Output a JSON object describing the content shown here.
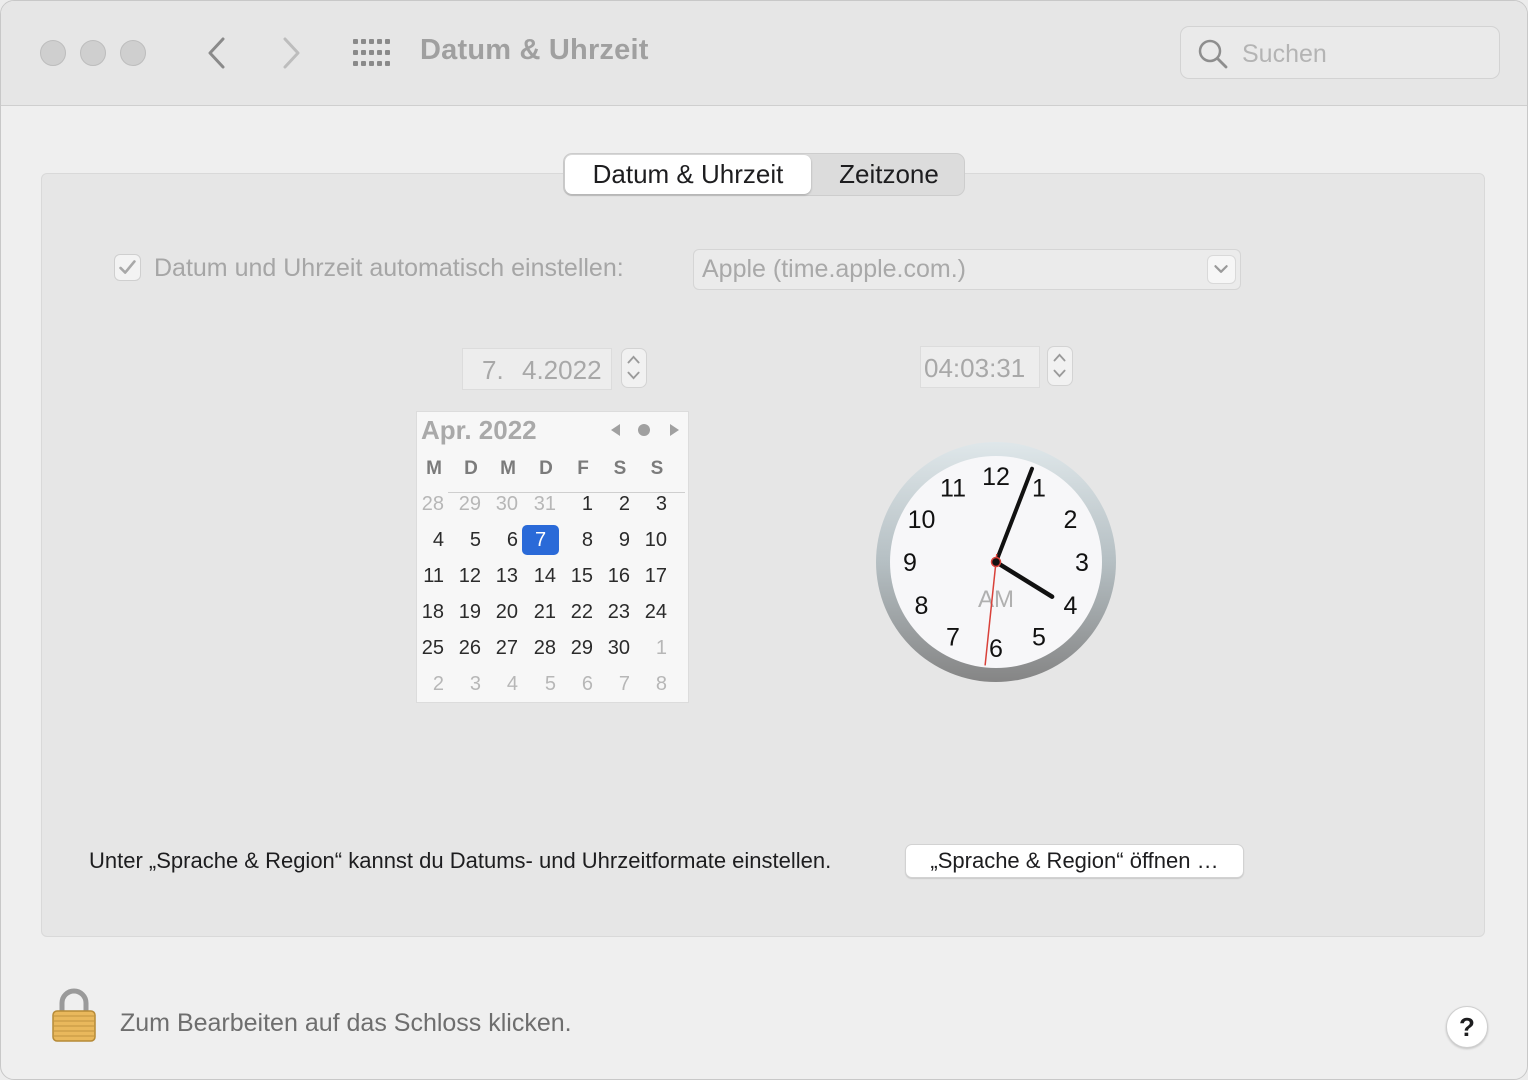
{
  "window": {
    "title": "Datum & Uhrzeit",
    "search_placeholder": "Suchen"
  },
  "tabs": [
    {
      "label": "Datum & Uhrzeit",
      "selected": true
    },
    {
      "label": "Zeitzone",
      "selected": false
    }
  ],
  "auto_time": {
    "checked": true,
    "label": "Datum und Uhrzeit automatisch einstellen:",
    "server": "Apple (time.apple.com.)"
  },
  "date_field": {
    "day": "7.",
    "rest": "4.2022"
  },
  "time_field": "04:03:31",
  "calendar": {
    "month_label": "Apr. 2022",
    "weekday_headers": [
      "M",
      "D",
      "M",
      "D",
      "F",
      "S",
      "S"
    ],
    "selected_day": "7",
    "weeks": [
      [
        {
          "d": "28",
          "dim": true
        },
        {
          "d": "29",
          "dim": true
        },
        {
          "d": "30",
          "dim": true
        },
        {
          "d": "31",
          "dim": true
        },
        {
          "d": "1"
        },
        {
          "d": "2"
        },
        {
          "d": "3"
        }
      ],
      [
        {
          "d": "4"
        },
        {
          "d": "5"
        },
        {
          "d": "6"
        },
        {
          "d": "7",
          "sel": true
        },
        {
          "d": "8"
        },
        {
          "d": "9"
        },
        {
          "d": "10"
        }
      ],
      [
        {
          "d": "11"
        },
        {
          "d": "12"
        },
        {
          "d": "13"
        },
        {
          "d": "14"
        },
        {
          "d": "15"
        },
        {
          "d": "16"
        },
        {
          "d": "17"
        }
      ],
      [
        {
          "d": "18"
        },
        {
          "d": "19"
        },
        {
          "d": "20"
        },
        {
          "d": "21"
        },
        {
          "d": "22"
        },
        {
          "d": "23"
        },
        {
          "d": "24"
        }
      ],
      [
        {
          "d": "25"
        },
        {
          "d": "26"
        },
        {
          "d": "27"
        },
        {
          "d": "28"
        },
        {
          "d": "29"
        },
        {
          "d": "30"
        },
        {
          "d": "1",
          "dim": true
        }
      ],
      [
        {
          "d": "2",
          "dim": true
        },
        {
          "d": "3",
          "dim": true
        },
        {
          "d": "4",
          "dim": true
        },
        {
          "d": "5",
          "dim": true
        },
        {
          "d": "6",
          "dim": true
        },
        {
          "d": "7",
          "dim": true
        },
        {
          "d": "8",
          "dim": true
        }
      ]
    ]
  },
  "clock": {
    "numbers": [
      "12",
      "1",
      "2",
      "3",
      "4",
      "5",
      "6",
      "7",
      "8",
      "9",
      "10",
      "11"
    ],
    "period": "AM",
    "hour": 4,
    "minute": 3,
    "second": 31
  },
  "footer": {
    "region_hint": "Unter „Sprache & Region“ kannst du Datums- und Uhrzeitformate einstellen.",
    "region_button": "„Sprache & Region“ öffnen …",
    "lock_text": "Zum Bearbeiten auf das Schloss klicken.",
    "help_label": "?"
  },
  "colors": {
    "accent": "#2a6ad8",
    "second_hand": "#d9413a"
  }
}
